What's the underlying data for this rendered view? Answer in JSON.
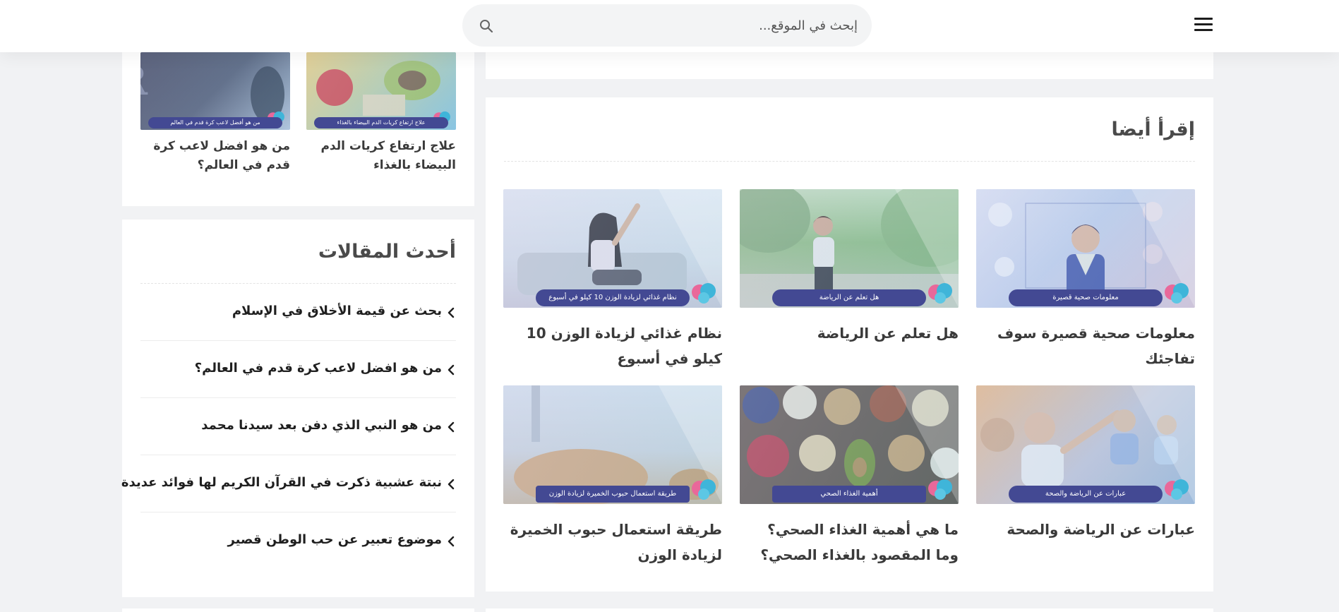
{
  "header": {
    "search_placeholder": "إبحث في الموقع..."
  },
  "read_also": {
    "title": "إقرأ أيضا",
    "posts": [
      {
        "title": "معلومات صحية قصيرة سوف تفاجئك",
        "tag": "معلومات صحية قصيرة"
      },
      {
        "title": "هل تعلم عن الرياضة",
        "tag": "هل تعلم عن الرياضة"
      },
      {
        "title": "نظام غذائي لزيادة الوزن 10 كيلو في أسبوع",
        "tag": "نظام غذائي لزيادة الوزن 10 كيلو في أسبوع"
      },
      {
        "title": "عبارات عن الرياضة والصحة",
        "tag": "عبارات عن الرياضة والصحة"
      },
      {
        "title": "ما هي أهمية الغذاء الصحي؟ وما المقصود بالغذاء الصحي؟",
        "tag": "أهمية الغذاء الصحي"
      },
      {
        "title": "طريقة استعمال حبوب الخميرة لزيادة الوزن",
        "tag": "طريقة استعمال حبوب الخميرة لزيادة الوزن"
      }
    ]
  },
  "sidebar_posts": [
    {
      "title": "علاج ارتفاع كريات الدم البيضاء بالغذاء",
      "tag": "علاج ارتفاع كريات الدم البيضاء بالغذاء"
    },
    {
      "title": "من هو افضل لاعب كرة قدم في العالم؟",
      "tag": "من هو أفضل لاعب كرة قدم في العالم"
    }
  ],
  "latest": {
    "title": "أحدث المقالات",
    "items": [
      "بحث عن قيمة الأخلاق في الإسلام",
      "من هو افضل لاعب كرة قدم في العالم؟",
      "من هو النبي الذي دفن بعد سيدنا محمد",
      "نبتة عشبية ذكرت في القرآن الكريم لها فوائد عديدة",
      "موضوع تعبير عن حب الوطن قصير"
    ]
  },
  "colors": {
    "tag_bg": "#434993",
    "page_bg": "#f1f2f4"
  }
}
